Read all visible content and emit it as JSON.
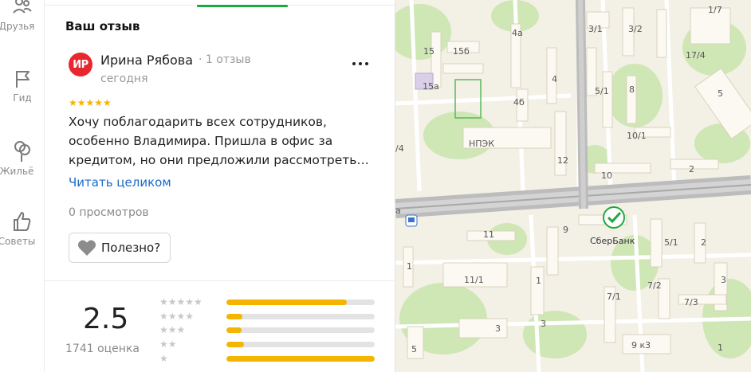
{
  "rail": {
    "items": [
      {
        "label": "Друзья",
        "icon": "friends-icon"
      },
      {
        "label": "Гид",
        "icon": "flag-icon"
      },
      {
        "label": "Жильё",
        "icon": "housing-icon"
      },
      {
        "label": "Советы",
        "icon": "thumbs-up-icon"
      }
    ]
  },
  "review": {
    "section_title": "Ваш отзыв",
    "avatar_initials": "ИР",
    "author_name": "Ирина Рябова",
    "author_meta": "· 1 отзыв",
    "date": "сегодня",
    "stars": 5,
    "stars_text": "★★★★★",
    "text": "Хочу поблагодарить всех сотрудников, особенно Владимира. Пришла в офис за кредитом, но они предложили рассмотреть…",
    "read_more": "Читать целиком",
    "views": "0 просмотров",
    "useful_label": "Полезно?"
  },
  "rating": {
    "value": "2.5",
    "count": "1741 оценка",
    "distribution": [
      {
        "stars": 5,
        "stars_text": "★★★★★",
        "fraction": 0.81
      },
      {
        "stars": 4,
        "stars_text": "★★★★",
        "fraction": 0.11
      },
      {
        "stars": 3,
        "stars_text": "★★★",
        "fraction": 0.1
      },
      {
        "stars": 2,
        "stars_text": "★★",
        "fraction": 0.12
      },
      {
        "stars": 1,
        "stars_text": "★",
        "fraction": 1.0
      }
    ]
  },
  "map": {
    "poi_name": "СберБанк",
    "labels": [
      "1/7",
      "3/1",
      "3/2",
      "4а",
      "4",
      "15",
      "15б",
      "15а",
      "4б",
      "8",
      "5/1",
      "17/4",
      "5",
      "НПЭК",
      "10/1",
      "12",
      "10",
      "2",
      "/4",
      "a",
      "11",
      "9",
      "5/1",
      "2",
      "1",
      "11/1",
      "1",
      "7/1",
      "7/2",
      "7/3",
      "3",
      "3",
      "3",
      "5",
      "9 к3",
      "1"
    ],
    "colors": {
      "road": "#b9b9b9",
      "block": "#f3f0e6",
      "building": "#fbf9f1",
      "green": "#cfe6b5",
      "accent": "#1fa83f"
    }
  }
}
